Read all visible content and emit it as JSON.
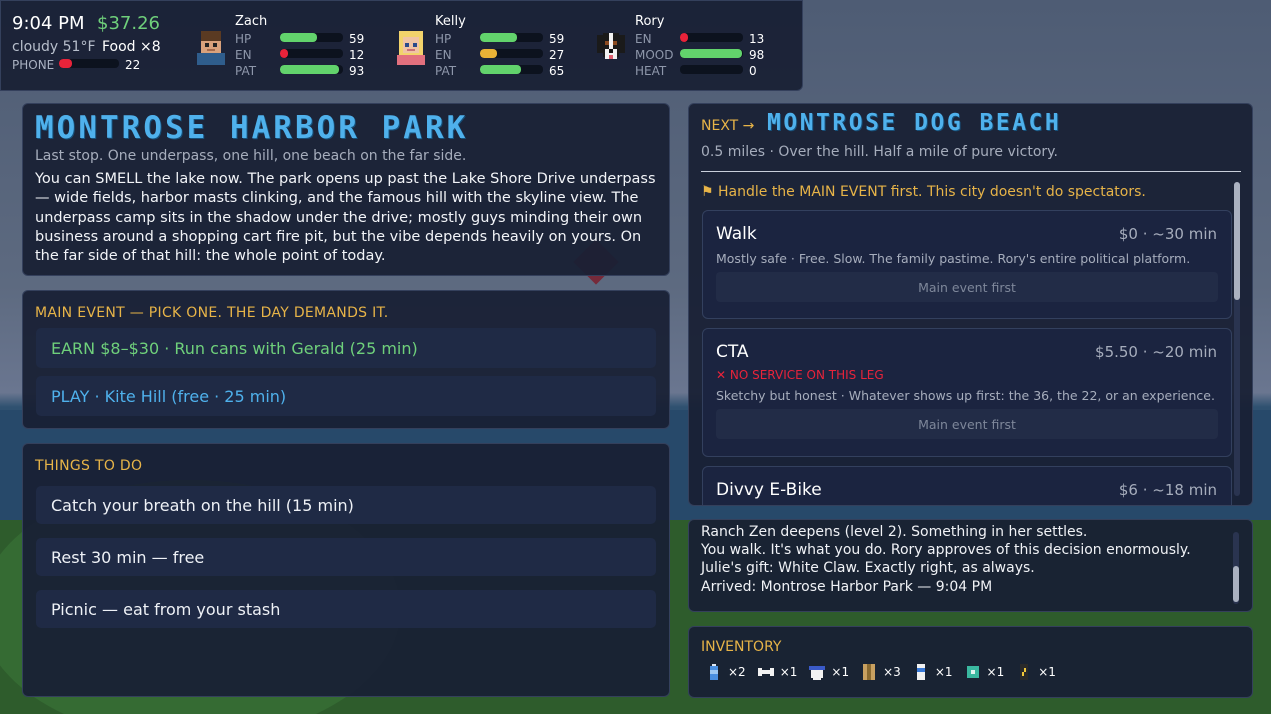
{
  "hud": {
    "time": "9:04 PM",
    "money": "$37.26",
    "weather": "cloudy 51°F",
    "food": "Food ×8",
    "phone_label": "PHONE",
    "phone_value": "22",
    "phone_fill": 0.22
  },
  "characters": [
    {
      "name": "Zach",
      "avatar_icon": "zach-portrait-icon",
      "stats": [
        {
          "label": "HP",
          "value": "59",
          "fill": 0.59,
          "color": "#62d36c"
        },
        {
          "label": "EN",
          "value": "12",
          "fill": 0.12,
          "color": "#e8233a"
        },
        {
          "label": "PAT",
          "value": "93",
          "fill": 0.93,
          "color": "#62d36c"
        }
      ]
    },
    {
      "name": "Kelly",
      "avatar_icon": "kelly-portrait-icon",
      "stats": [
        {
          "label": "HP",
          "value": "59",
          "fill": 0.59,
          "color": "#62d36c"
        },
        {
          "label": "EN",
          "value": "27",
          "fill": 0.27,
          "color": "#e9b236"
        },
        {
          "label": "PAT",
          "value": "65",
          "fill": 0.65,
          "color": "#62d36c"
        }
      ]
    },
    {
      "name": "Rory",
      "avatar_icon": "rory-dog-portrait-icon",
      "stats": [
        {
          "label": "EN",
          "value": "13",
          "fill": 0.13,
          "color": "#e8233a"
        },
        {
          "label": "MOOD",
          "value": "98",
          "fill": 0.98,
          "color": "#62d36c"
        },
        {
          "label": "HEAT",
          "value": "0",
          "fill": 0.0,
          "color": "#62d36c"
        }
      ]
    }
  ],
  "location": {
    "title": "MONTROSE HARBOR PARK",
    "subtitle": "Last stop. One underpass, one hill, one beach on the far side.",
    "body": "You can SMELL the lake now. The park opens up past the Lake Shore Drive underpass — wide fields, harbor masts clinking, and the famous hill with the skyline view. The underpass camp sits in the shadow under the drive; mostly guys minding their own business around a shopping cart fire pit, but the vibe depends heavily on yours. On the far side of that hill: the whole point of today."
  },
  "main_event": {
    "heading": "MAIN EVENT — PICK ONE. THE DAY DEMANDS IT.",
    "earn": "EARN $8–$30 · Run cans with Gerald  (25 min)",
    "play": "PLAY · Kite Hill  (free · 25 min)"
  },
  "things": {
    "heading": "THINGS TO DO",
    "items": [
      "Catch your breath on the hill  (15 min)",
      "Rest 30 min — free",
      "Picnic — eat from your stash"
    ]
  },
  "next": {
    "prefix": "NEXT →",
    "title": "MONTROSE DOG BEACH",
    "subtitle": "0.5 miles · Over the hill. Half a mile of pure victory.",
    "warning": "⚑ Handle the MAIN EVENT first. This city doesn't do spectators.",
    "routes": [
      {
        "name": "Walk",
        "cost": "$0 · ~30 min",
        "desc": "Mostly safe  ·  Free. Slow. The family pastime. Rory's entire political platform.",
        "button": "Main event first"
      },
      {
        "name": "CTA",
        "cost": "$5.50 · ~20 min",
        "warn": "✕ NO SERVICE ON THIS LEG",
        "desc": "Sketchy but honest  ·  Whatever shows up first: the 36, the 22, or an experience.",
        "button": "Main event first"
      },
      {
        "name": "Divvy E-Bike",
        "cost": "$6 · ~18 min"
      }
    ]
  },
  "log": {
    "lines": [
      "Ranch Zen deepens (level 2). Something in her settles.",
      "You walk. It's what you do. Rory approves of this decision enormously.",
      "Julie's gift: White Claw. Exactly right, as always.",
      "Arrived: Montrose Harbor Park — 9:04 PM"
    ]
  },
  "inventory": {
    "heading": "INVENTORY",
    "items": [
      {
        "icon": "water-bottle-icon",
        "count": "×2"
      },
      {
        "icon": "bone-icon",
        "count": "×1"
      },
      {
        "icon": "cup-icon",
        "count": "×1"
      },
      {
        "icon": "box-icon",
        "count": "×3"
      },
      {
        "icon": "can-icon",
        "count": "×1"
      },
      {
        "icon": "teal-item-icon",
        "count": "×1"
      },
      {
        "icon": "energy-drink-icon",
        "count": "×1"
      }
    ]
  }
}
